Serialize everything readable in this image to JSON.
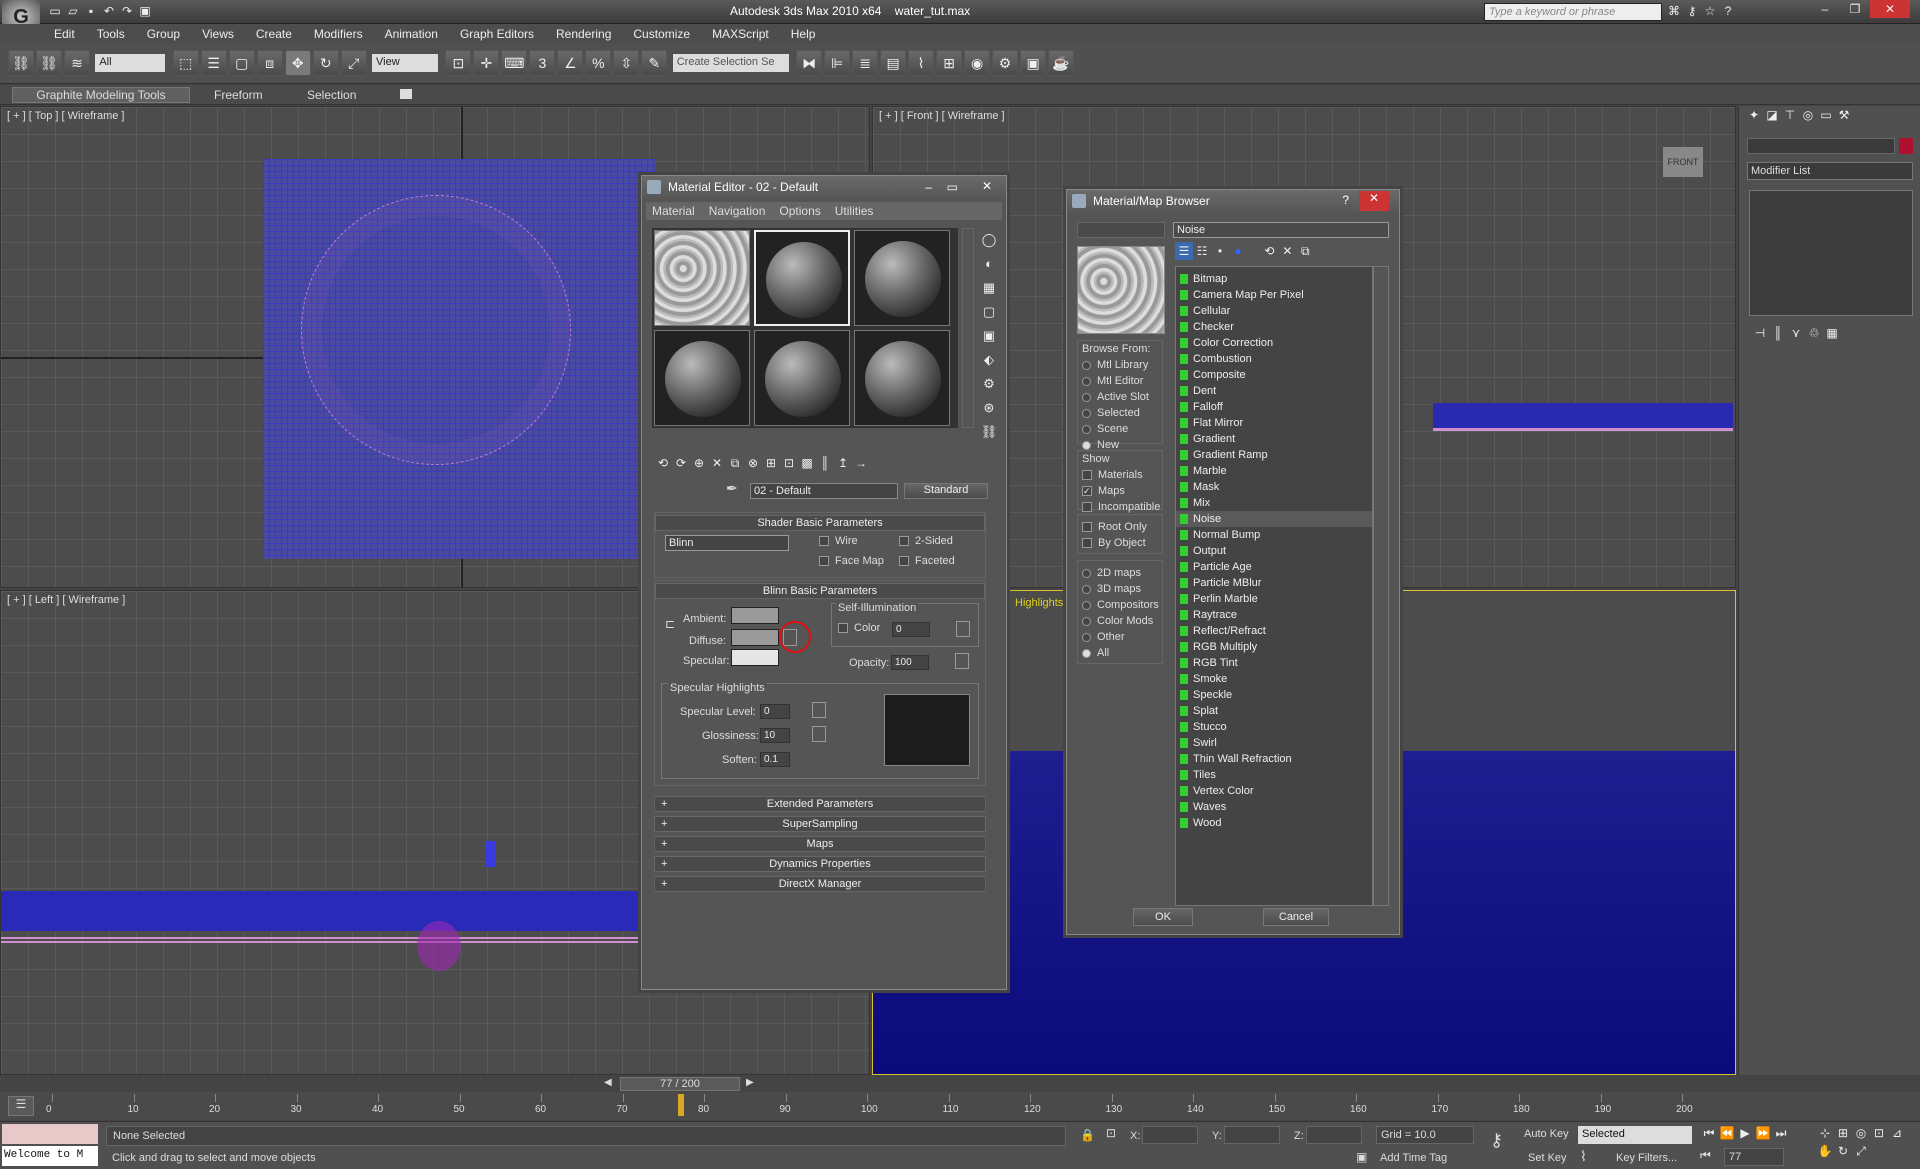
{
  "title": {
    "app": "Autodesk 3ds Max 2010 x64",
    "file": "water_tut.max",
    "search_placeholder": "Type a keyword or phrase"
  },
  "menu": [
    "Edit",
    "Tools",
    "Group",
    "Views",
    "Create",
    "Modifiers",
    "Animation",
    "Graph Editors",
    "Rendering",
    "Customize",
    "MAXScript",
    "Help"
  ],
  "toolbar": {
    "filter": "All",
    "ref_coord": "View",
    "selection_set": "Create Selection Se"
  },
  "ribbon": {
    "tabs": [
      "Graphite Modeling Tools",
      "Freeform",
      "Selection"
    ]
  },
  "viewports": {
    "top": "[ + ] [ Top ] [ Wireframe ]",
    "front": "[ + ] [ Front ] [ Wireframe ]",
    "left": "[ + ] [ Left ] [ Wireframe ]",
    "perspective_label": "Highlights"
  },
  "cmdpanel": {
    "modifier_list": "Modifier List"
  },
  "mat_editor": {
    "title": "Material Editor - 02 - Default",
    "menu": [
      "Material",
      "Navigation",
      "Options",
      "Utilities"
    ],
    "material_name": "02 - Default",
    "material_type": "Standard",
    "shader_section": "Shader Basic Parameters",
    "shader": "Blinn",
    "shader_opts": [
      "Wire",
      "2-Sided",
      "Face Map",
      "Faceted"
    ],
    "blinn_section": "Blinn Basic Parameters",
    "self_illum": "Self-Illumination",
    "color_label": "Color",
    "color_value": "0",
    "ambient": "Ambient:",
    "diffuse": "Diffuse:",
    "specular": "Specular:",
    "opacity_label": "Opacity:",
    "opacity_value": "100",
    "spec_highlights": "Specular Highlights",
    "spec_level_label": "Specular Level:",
    "spec_level": "0",
    "gloss_label": "Glossiness:",
    "gloss": "10",
    "soften_label": "Soften:",
    "soften": "0.1",
    "rollouts": [
      "Extended Parameters",
      "SuperSampling",
      "Maps",
      "Dynamics Properties",
      "DirectX Manager"
    ]
  },
  "browser": {
    "title": "Material/Map Browser",
    "name_field": "Noise",
    "browse_from_label": "Browse From:",
    "browse_from": [
      "Mtl Library",
      "Mtl Editor",
      "Active Slot",
      "Selected",
      "Scene",
      "New"
    ],
    "show_label": "Show",
    "show": [
      "Materials",
      "Maps",
      "Incompatible"
    ],
    "root": [
      "Root Only",
      "By Object"
    ],
    "filter": [
      "2D maps",
      "3D maps",
      "Compositors",
      "Color Mods",
      "Other",
      "All"
    ],
    "maps": [
      "Bitmap",
      "Camera Map Per Pixel",
      "Cellular",
      "Checker",
      "Color Correction",
      "Combustion",
      "Composite",
      "Dent",
      "Falloff",
      "Flat Mirror",
      "Gradient",
      "Gradient Ramp",
      "Marble",
      "Mask",
      "Mix",
      "Noise",
      "Normal Bump",
      "Output",
      "Particle Age",
      "Particle MBlur",
      "Perlin Marble",
      "Raytrace",
      "Reflect/Refract",
      "RGB Multiply",
      "RGB Tint",
      "Smoke",
      "Speckle",
      "Splat",
      "Stucco",
      "Swirl",
      "Thin Wall Refraction",
      "Tiles",
      "Vertex Color",
      "Waves",
      "Wood"
    ],
    "ok": "OK",
    "cancel": "Cancel"
  },
  "timeline": {
    "frame": "77 / 200",
    "ticks": [
      "0",
      "10",
      "20",
      "30",
      "40",
      "50",
      "60",
      "70",
      "80",
      "90",
      "100",
      "110",
      "120",
      "130",
      "140",
      "150",
      "160",
      "170",
      "180",
      "190",
      "200"
    ]
  },
  "status": {
    "maxscript": "Welcome to M",
    "selected": "None Selected",
    "prompt": "Click and drag to select and move objects",
    "x_label": "X:",
    "y_label": "Y:",
    "z_label": "Z:",
    "grid": "Grid = 10.0",
    "add_time_tag": "Add Time Tag",
    "auto_key": "Auto Key",
    "set_key": "Set Key",
    "key_mode": "Selected",
    "key_filters": "Key Filters...",
    "frame_field": "77"
  }
}
